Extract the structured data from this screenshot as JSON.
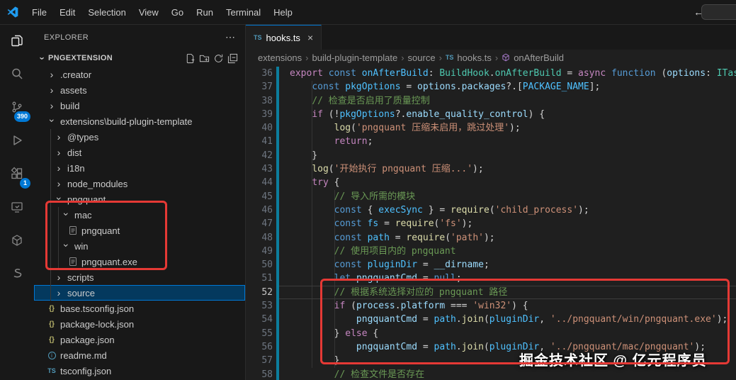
{
  "titlebar": {
    "menus": [
      "File",
      "Edit",
      "Selection",
      "View",
      "Go",
      "Run",
      "Terminal",
      "Help"
    ],
    "back_label": "←",
    "forward_label": "→"
  },
  "activity_bar": {
    "scm_badge": "390",
    "extensions_badge": "1",
    "icons": [
      "files-icon",
      "search-icon",
      "source-control-icon",
      "run-debug-icon",
      "extensions-icon",
      "remote-preview-icon",
      "cube-icon",
      "s-curve-icon"
    ]
  },
  "explorer": {
    "title": "EXPLORER",
    "more_icon": "⋯",
    "section": "PNGEXTENSION",
    "items": [
      {
        "label": ".creator",
        "lvl": 0,
        "kind": "folder",
        "open": false
      },
      {
        "label": "assets",
        "lvl": 0,
        "kind": "folder",
        "open": false
      },
      {
        "label": "build",
        "lvl": 0,
        "kind": "folder",
        "open": false
      },
      {
        "label": "extensions\\build-plugin-template",
        "lvl": 0,
        "kind": "folder",
        "open": true
      },
      {
        "label": "@types",
        "lvl": 1,
        "kind": "folder",
        "open": false
      },
      {
        "label": "dist",
        "lvl": 1,
        "kind": "folder",
        "open": false
      },
      {
        "label": "i18n",
        "lvl": 1,
        "kind": "folder",
        "open": false
      },
      {
        "label": "node_modules",
        "lvl": 1,
        "kind": "folder",
        "open": false
      },
      {
        "label": "pngquant",
        "lvl": 1,
        "kind": "folder",
        "open": true
      },
      {
        "label": "mac",
        "lvl": 2,
        "kind": "folder",
        "open": true
      },
      {
        "label": "pngquant",
        "lvl": 3,
        "kind": "file",
        "icon": "file"
      },
      {
        "label": "win",
        "lvl": 2,
        "kind": "folder",
        "open": true
      },
      {
        "label": "pngquant.exe",
        "lvl": 3,
        "kind": "file",
        "icon": "file"
      },
      {
        "label": "scripts",
        "lvl": 1,
        "kind": "folder",
        "open": false
      },
      {
        "label": "source",
        "lvl": 1,
        "kind": "folder",
        "open": false,
        "selected": true
      },
      {
        "label": "base.tsconfig.json",
        "lvl": 0,
        "kind": "file",
        "icon": "json"
      },
      {
        "label": "package-lock.json",
        "lvl": 0,
        "kind": "file",
        "icon": "json"
      },
      {
        "label": "package.json",
        "lvl": 0,
        "kind": "file",
        "icon": "json"
      },
      {
        "label": "readme.md",
        "lvl": 0,
        "kind": "file",
        "icon": "info"
      },
      {
        "label": "tsconfig.json",
        "lvl": 0,
        "kind": "file",
        "icon": "ts"
      }
    ]
  },
  "editor": {
    "tab": {
      "label": "hooks.ts",
      "icon": "ts",
      "close": "×"
    },
    "breadcrumbs": [
      {
        "label": "extensions"
      },
      {
        "label": "build-plugin-template"
      },
      {
        "label": "source"
      },
      {
        "label": "hooks.ts",
        "icon": "ts"
      },
      {
        "label": "onAfterBuild",
        "icon": "method"
      }
    ],
    "current_line": 52,
    "lines": [
      {
        "n": 36,
        "t": [
          [
            "k",
            "export "
          ],
          [
            "b",
            "const "
          ],
          [
            "c",
            "onAfterBuild"
          ],
          [
            "p",
            ": "
          ],
          [
            "t",
            "BuildHook"
          ],
          [
            "p",
            "."
          ],
          [
            "t",
            "onAfterBuild"
          ],
          [
            "p",
            " = "
          ],
          [
            "k",
            "async "
          ],
          [
            "b",
            "function "
          ],
          [
            "p",
            "("
          ],
          [
            "v",
            "options"
          ],
          [
            "p",
            ": "
          ],
          [
            "t",
            "ITask"
          ]
        ]
      },
      {
        "n": 37,
        "t": [
          [
            "p",
            "    "
          ],
          [
            "b",
            "const "
          ],
          [
            "c",
            "pkgOptions"
          ],
          [
            "p",
            " = "
          ],
          [
            "v",
            "options"
          ],
          [
            "p",
            "."
          ],
          [
            "v",
            "packages"
          ],
          [
            "p",
            "?.["
          ],
          [
            "c",
            "PACKAGE_NAME"
          ],
          [
            "p",
            "];"
          ]
        ]
      },
      {
        "n": 38,
        "t": [
          [
            "p",
            "    "
          ],
          [
            "m",
            "// 检查是否启用了质量控制"
          ]
        ]
      },
      {
        "n": 39,
        "t": [
          [
            "p",
            "    "
          ],
          [
            "k",
            "if "
          ],
          [
            "p",
            "(!"
          ],
          [
            "c",
            "pkgOptions"
          ],
          [
            "p",
            "?."
          ],
          [
            "v",
            "enable_quality_control"
          ],
          [
            "p",
            ") {"
          ]
        ]
      },
      {
        "n": 40,
        "t": [
          [
            "p",
            "        "
          ],
          [
            "f",
            "log"
          ],
          [
            "p",
            "("
          ],
          [
            "s",
            "'pngquant 压缩未启用，跳过处理'"
          ],
          [
            "p",
            ");"
          ]
        ]
      },
      {
        "n": 41,
        "t": [
          [
            "p",
            "        "
          ],
          [
            "k",
            "return"
          ],
          [
            "p",
            ";"
          ]
        ]
      },
      {
        "n": 42,
        "t": [
          [
            "p",
            "    }"
          ]
        ]
      },
      {
        "n": 43,
        "t": [
          [
            "p",
            "    "
          ],
          [
            "f",
            "log"
          ],
          [
            "p",
            "("
          ],
          [
            "s",
            "'开始执行 pngquant 压缩...'"
          ],
          [
            "p",
            ");"
          ]
        ]
      },
      {
        "n": 44,
        "t": [
          [
            "p",
            "    "
          ],
          [
            "k",
            "try "
          ],
          [
            "p",
            "{"
          ]
        ]
      },
      {
        "n": 45,
        "t": [
          [
            "p",
            "        "
          ],
          [
            "m",
            "// 导入所需的模块"
          ]
        ]
      },
      {
        "n": 46,
        "t": [
          [
            "p",
            "        "
          ],
          [
            "b",
            "const "
          ],
          [
            "p",
            "{ "
          ],
          [
            "c",
            "execSync"
          ],
          [
            "p",
            " } = "
          ],
          [
            "f",
            "require"
          ],
          [
            "p",
            "("
          ],
          [
            "s",
            "'child_process'"
          ],
          [
            "p",
            ");"
          ]
        ]
      },
      {
        "n": 47,
        "t": [
          [
            "p",
            "        "
          ],
          [
            "b",
            "const "
          ],
          [
            "c",
            "fs"
          ],
          [
            "p",
            " = "
          ],
          [
            "f",
            "require"
          ],
          [
            "p",
            "("
          ],
          [
            "s",
            "'fs'"
          ],
          [
            "p",
            ");"
          ]
        ]
      },
      {
        "n": 48,
        "t": [
          [
            "p",
            "        "
          ],
          [
            "b",
            "const "
          ],
          [
            "c",
            "path"
          ],
          [
            "p",
            " = "
          ],
          [
            "f",
            "require"
          ],
          [
            "p",
            "("
          ],
          [
            "s",
            "'path'"
          ],
          [
            "p",
            ");"
          ]
        ]
      },
      {
        "n": 49,
        "t": [
          [
            "p",
            "        "
          ],
          [
            "m",
            "// 使用项目内的 pngquant"
          ]
        ]
      },
      {
        "n": 50,
        "t": [
          [
            "p",
            "        "
          ],
          [
            "b",
            "const "
          ],
          [
            "c",
            "pluginDir"
          ],
          [
            "p",
            " = "
          ],
          [
            "v",
            "__dirname"
          ],
          [
            "p",
            ";"
          ]
        ]
      },
      {
        "n": 51,
        "t": [
          [
            "p",
            "        "
          ],
          [
            "b",
            "let "
          ],
          [
            "v",
            "pngquantCmd"
          ],
          [
            "p",
            " = "
          ],
          [
            "b",
            "null"
          ],
          [
            "p",
            ";"
          ]
        ]
      },
      {
        "n": 52,
        "t": [
          [
            "p",
            "        "
          ],
          [
            "m",
            "// 根据系统选择对应的 pngquant 路径"
          ]
        ]
      },
      {
        "n": 53,
        "t": [
          [
            "p",
            "        "
          ],
          [
            "k",
            "if "
          ],
          [
            "p",
            "("
          ],
          [
            "v",
            "process"
          ],
          [
            "p",
            "."
          ],
          [
            "v",
            "platform"
          ],
          [
            "p",
            " === "
          ],
          [
            "s",
            "'win32'"
          ],
          [
            "p",
            ") {"
          ]
        ]
      },
      {
        "n": 54,
        "t": [
          [
            "p",
            "            "
          ],
          [
            "v",
            "pngquantCmd"
          ],
          [
            "p",
            " = "
          ],
          [
            "c",
            "path"
          ],
          [
            "p",
            "."
          ],
          [
            "f",
            "join"
          ],
          [
            "p",
            "("
          ],
          [
            "c",
            "pluginDir"
          ],
          [
            "p",
            ", "
          ],
          [
            "s",
            "'../pngquant/win/pngquant.exe'"
          ],
          [
            "p",
            ");"
          ]
        ]
      },
      {
        "n": 55,
        "t": [
          [
            "p",
            "        } "
          ],
          [
            "k",
            "else "
          ],
          [
            "p",
            "{"
          ]
        ]
      },
      {
        "n": 56,
        "t": [
          [
            "p",
            "            "
          ],
          [
            "v",
            "pngquantCmd"
          ],
          [
            "p",
            " = "
          ],
          [
            "c",
            "path"
          ],
          [
            "p",
            "."
          ],
          [
            "f",
            "join"
          ],
          [
            "p",
            "("
          ],
          [
            "c",
            "pluginDir"
          ],
          [
            "p",
            ", "
          ],
          [
            "s",
            "'../pngquant/mac/pngquant'"
          ],
          [
            "p",
            ");"
          ]
        ]
      },
      {
        "n": 57,
        "t": [
          [
            "p",
            "        }"
          ]
        ]
      },
      {
        "n": 58,
        "t": [
          [
            "p",
            "        "
          ],
          [
            "m",
            "// 检查文件是否存在"
          ]
        ]
      }
    ]
  },
  "watermark": "掘金技术社区 @ 亿元程序员",
  "colors": {
    "accent": "#0078d4",
    "annotation_red": "#e53935",
    "editor_bg": "#1f1f1f",
    "panel_bg": "#181818",
    "keyword": "#c586c0",
    "keyword2": "#569cd6",
    "type": "#4ec9b0",
    "variable": "#9cdcfe",
    "constant": "#4fc1ff",
    "function": "#dcdcaa",
    "string": "#ce9178",
    "comment": "#6a9955",
    "badge_bg": "#0078d4"
  }
}
